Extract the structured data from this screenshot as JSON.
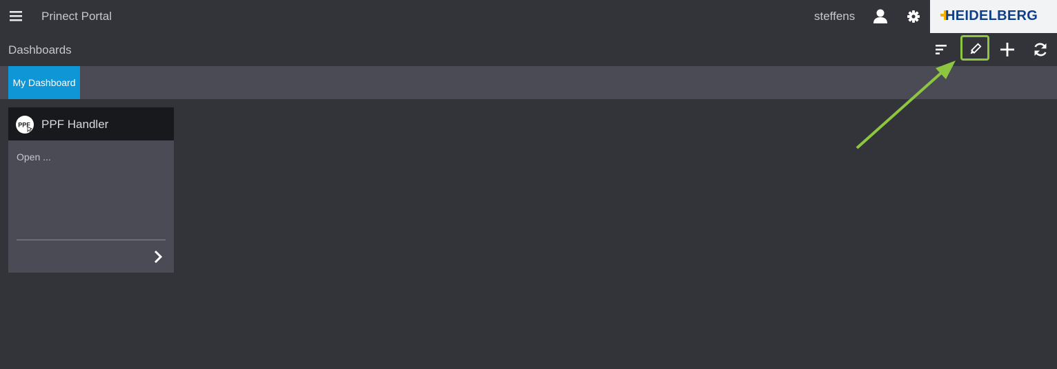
{
  "header": {
    "app_title": "Prinect Portal",
    "username": "steffens",
    "logo_text": "HEIDELBERG",
    "icons": {
      "menu": "menu-icon",
      "user": "user-icon",
      "settings": "gear-icon"
    }
  },
  "subheader": {
    "title": "Dashboards",
    "toolbar": [
      {
        "name": "sort-list",
        "icon": "sort-icon"
      },
      {
        "name": "edit",
        "icon": "pencil-icon"
      },
      {
        "name": "add",
        "icon": "plus-icon"
      },
      {
        "name": "refresh",
        "icon": "refresh-icon"
      }
    ]
  },
  "tabs": [
    {
      "label": "My Dashboard",
      "active": true
    }
  ],
  "widgets": [
    {
      "icon_text": "PPF",
      "title": "PPF Handler",
      "body": "Open ..."
    }
  ],
  "colors": {
    "background": "#333439",
    "tab_active": "#0e96d6",
    "highlight": "#8dc63f",
    "logo": "#0f3f8a"
  }
}
